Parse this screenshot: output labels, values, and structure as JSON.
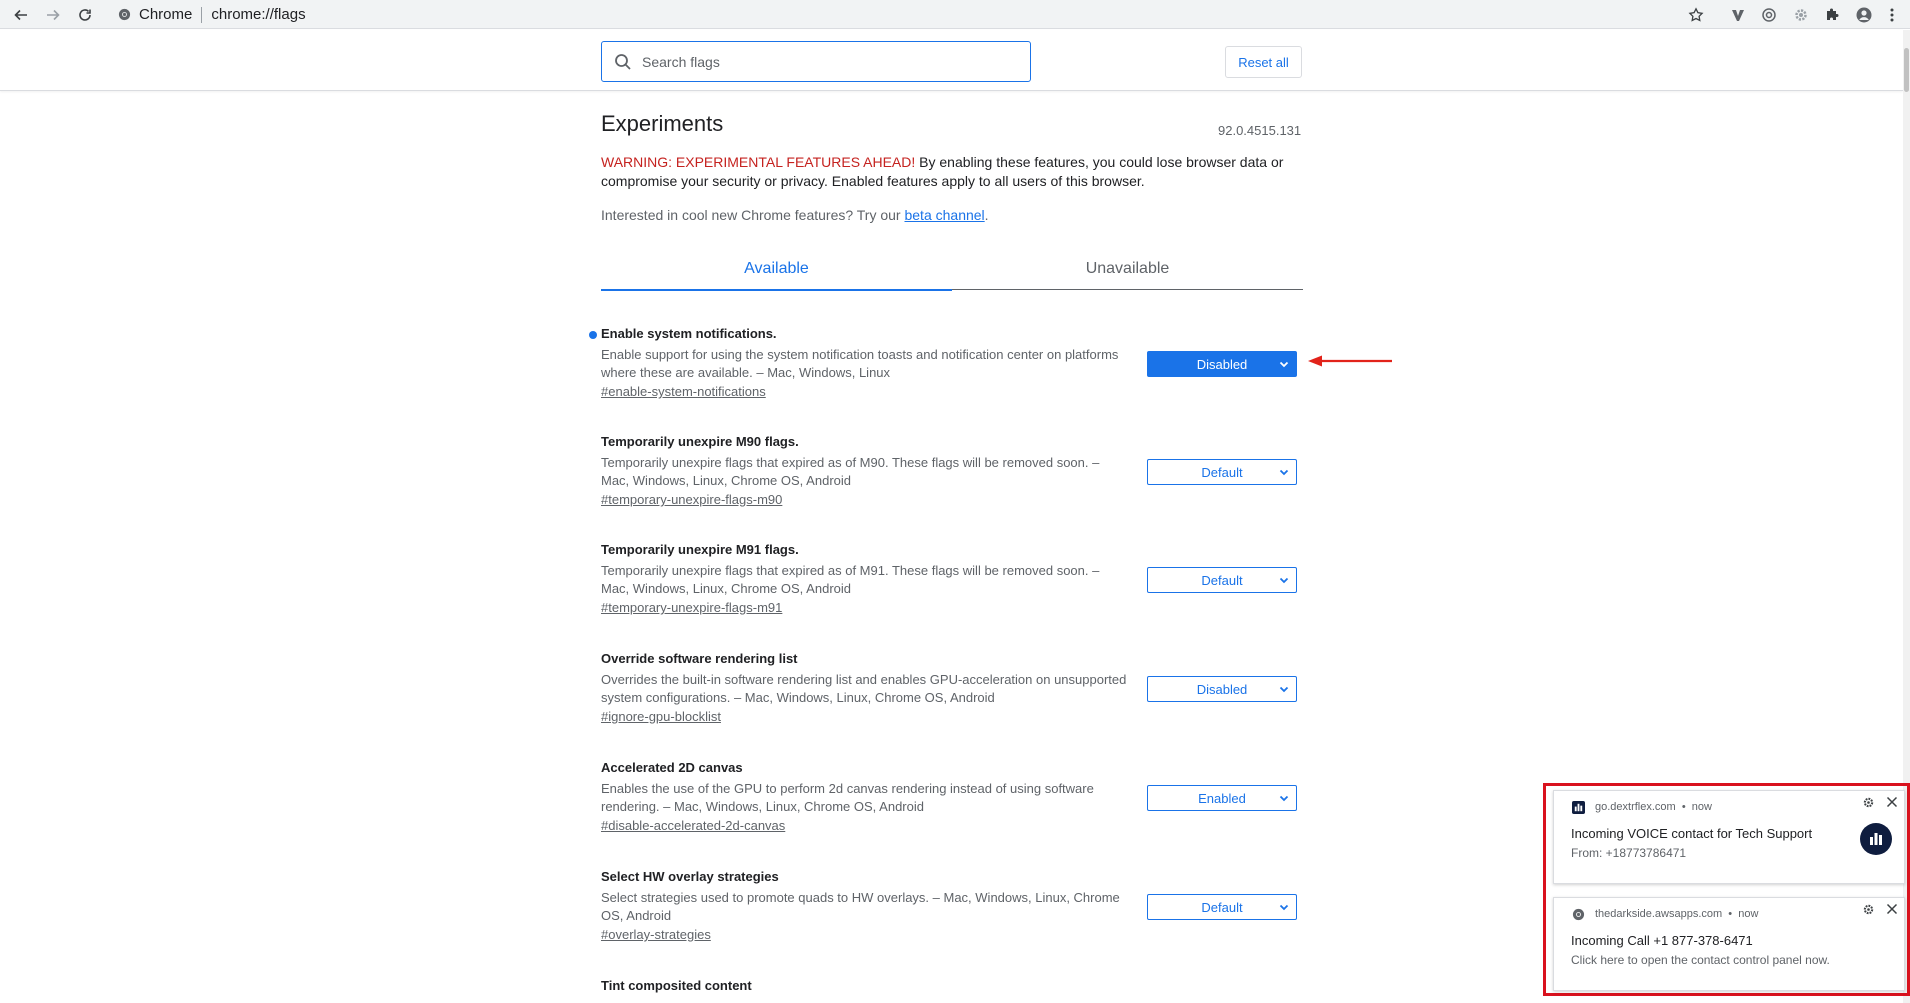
{
  "browser": {
    "site_label": "Chrome",
    "url": "chrome://flags"
  },
  "header": {
    "search_placeholder": "Search flags",
    "reset_label": "Reset all"
  },
  "main": {
    "title": "Experiments",
    "version": "92.0.4515.131",
    "warning_strong": "WARNING: EXPERIMENTAL FEATURES AHEAD!",
    "warning_rest": " By enabling these features, you could lose browser data or compromise your security or privacy. Enabled features apply to all users of this browser.",
    "interested_prefix": "Interested in cool new Chrome features? Try our ",
    "beta_link": "beta channel",
    "interested_suffix": ".",
    "tabs": [
      {
        "label": "Available"
      },
      {
        "label": "Unavailable"
      }
    ]
  },
  "flags": [
    {
      "title": "Enable system notifications.",
      "description": "Enable support for using the system notification toasts and notification center on platforms where these are available. – Mac, Windows, Linux",
      "link": "#enable-system-notifications",
      "value": "Disabled"
    },
    {
      "title": "Temporarily unexpire M90 flags.",
      "description": "Temporarily unexpire flags that expired as of M90. These flags will be removed soon. – Mac, Windows, Linux, Chrome OS, Android",
      "link": "#temporary-unexpire-flags-m90",
      "value": "Default"
    },
    {
      "title": "Temporarily unexpire M91 flags.",
      "description": "Temporarily unexpire flags that expired as of M91. These flags will be removed soon. – Mac, Windows, Linux, Chrome OS, Android",
      "link": "#temporary-unexpire-flags-m91",
      "value": "Default"
    },
    {
      "title": "Override software rendering list",
      "description": "Overrides the built-in software rendering list and enables GPU-acceleration on unsupported system configurations. – Mac, Windows, Linux, Chrome OS, Android",
      "link": "#ignore-gpu-blocklist",
      "value": "Disabled"
    },
    {
      "title": "Accelerated 2D canvas",
      "description": "Enables the use of the GPU to perform 2d canvas rendering instead of using software rendering. – Mac, Windows, Linux, Chrome OS, Android",
      "link": "#disable-accelerated-2d-canvas",
      "value": "Enabled"
    },
    {
      "title": "Select HW overlay strategies",
      "description": "Select strategies used to promote quads to HW overlays. – Mac, Windows, Linux, Chrome OS, Android",
      "link": "#overlay-strategies",
      "value": "Default"
    },
    {
      "title": "Tint composited content",
      "description": "",
      "link": "",
      "value": ""
    }
  ],
  "notifications": [
    {
      "site": "go.dextrflex.com",
      "time": "now",
      "title": "Incoming VOICE contact for Tech Support",
      "body": "From: +18773786471"
    },
    {
      "site": "thedarkside.awsapps.com",
      "time": "now",
      "title": "Incoming Call +1 877-378-6471",
      "body": "Click here to open the contact control panel now."
    }
  ],
  "colors": {
    "accent": "#1a73e8",
    "warning": "#c5221f",
    "highlight_outline": "#d9121e"
  }
}
